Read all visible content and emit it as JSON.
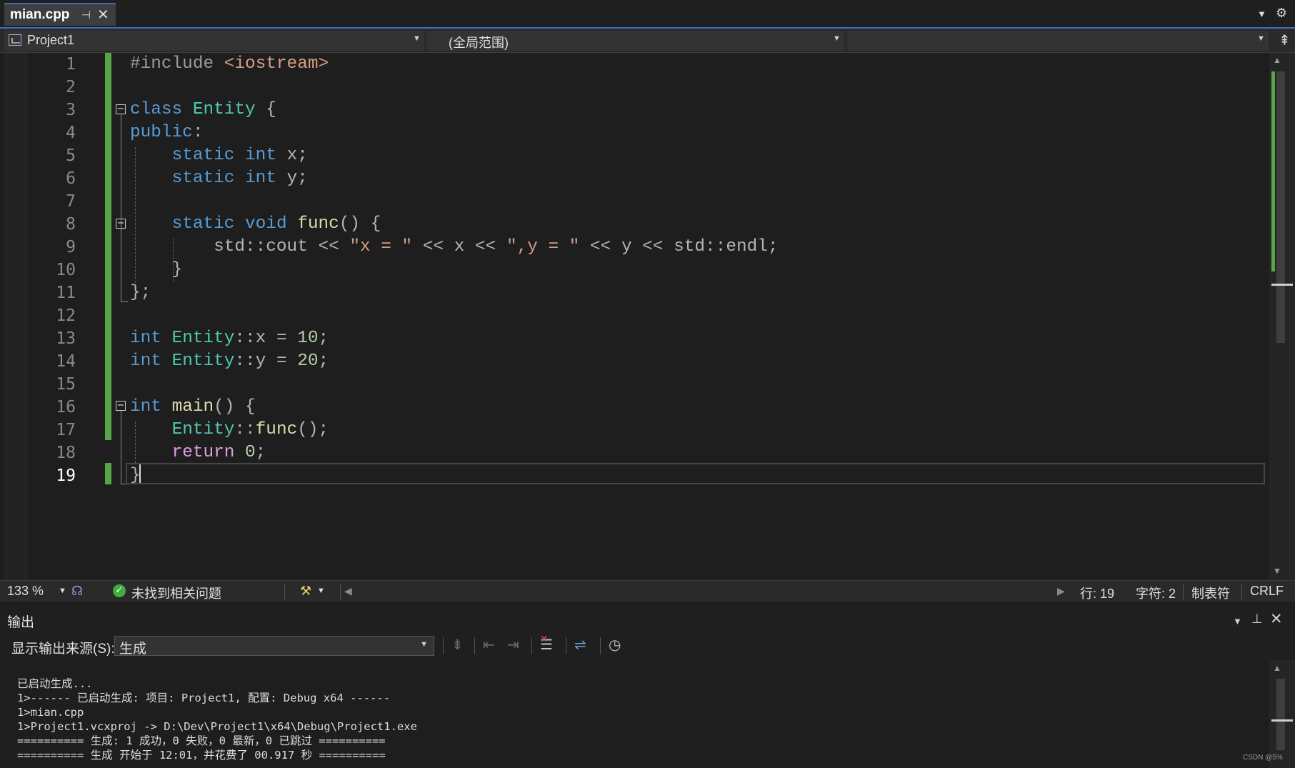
{
  "tab": {
    "title": "mian.cpp",
    "pin_icon": "pin-icon",
    "close_icon": "close-icon"
  },
  "navbar": {
    "project": "Project1",
    "scope": "(全局范围)",
    "member": ""
  },
  "editor": {
    "line_numbers": [
      "1",
      "2",
      "3",
      "4",
      "5",
      "6",
      "7",
      "8",
      "9",
      "10",
      "11",
      "12",
      "13",
      "14",
      "15",
      "16",
      "17",
      "18",
      "19"
    ],
    "current_line": 19,
    "code": [
      [
        [
          "pp",
          "#include "
        ],
        [
          "st",
          "<iostream>"
        ]
      ],
      [],
      [
        [
          "kw",
          "class "
        ],
        [
          "ty",
          "Entity "
        ],
        [
          "pu",
          "{"
        ]
      ],
      [
        [
          "kw",
          "public"
        ],
        [
          "pu",
          ":"
        ]
      ],
      [
        [
          "pu",
          "    "
        ],
        [
          "kw",
          "static "
        ],
        [
          "kw",
          "int "
        ],
        [
          "pu",
          "x;"
        ]
      ],
      [
        [
          "pu",
          "    "
        ],
        [
          "kw",
          "static "
        ],
        [
          "kw",
          "int "
        ],
        [
          "pu",
          "y;"
        ]
      ],
      [],
      [
        [
          "pu",
          "    "
        ],
        [
          "kw",
          "static "
        ],
        [
          "kw",
          "void "
        ],
        [
          "fn",
          "func"
        ],
        [
          "pu",
          "() {"
        ]
      ],
      [
        [
          "pu",
          "        std::cout << "
        ],
        [
          "st",
          "\"x = \""
        ],
        [
          "pu",
          " << x << "
        ],
        [
          "st",
          "\",y = \""
        ],
        [
          "pu",
          " << y << std::endl;"
        ]
      ],
      [
        [
          "pu",
          "    }"
        ]
      ],
      [
        [
          "pu",
          "};"
        ]
      ],
      [],
      [
        [
          "kw",
          "int "
        ],
        [
          "ty",
          "Entity"
        ],
        [
          "pu",
          "::x = "
        ],
        [
          "nm",
          "10"
        ],
        [
          "pu",
          ";"
        ]
      ],
      [
        [
          "kw",
          "int "
        ],
        [
          "ty",
          "Entity"
        ],
        [
          "pu",
          "::y = "
        ],
        [
          "nm",
          "20"
        ],
        [
          "pu",
          ";"
        ]
      ],
      [],
      [
        [
          "kw",
          "int "
        ],
        [
          "fn",
          "main"
        ],
        [
          "pu",
          "() {"
        ]
      ],
      [
        [
          "pu",
          "    "
        ],
        [
          "ty",
          "Entity"
        ],
        [
          "pu",
          "::"
        ],
        [
          "fn",
          "func"
        ],
        [
          "pu",
          "();"
        ]
      ],
      [
        [
          "pu",
          "    "
        ],
        [
          "ctl",
          "return "
        ],
        [
          "nm",
          "0"
        ],
        [
          "pu",
          ";"
        ]
      ],
      [
        [
          "pu",
          "}"
        ]
      ]
    ]
  },
  "status": {
    "zoom": "133 %",
    "issues": "未找到相关问题",
    "line": "行: 19",
    "char": "字符: 2",
    "indent": "制表符",
    "eol": "CRLF"
  },
  "output": {
    "title": "输出",
    "source_label": "显示输出来源(S):",
    "source_value": "生成",
    "lines": [
      "已启动生成...",
      "1>------ 已启动生成: 项目: Project1, 配置: Debug x64 ------",
      "1>mian.cpp",
      "1>Project1.vcxproj -> D:\\Dev\\Project1\\x64\\Debug\\Project1.exe",
      "========== 生成: 1 成功，0 失败，0 最新，0 已跳过 ==========",
      "========== 生成 开始于 12:01，并花费了 00.917 秒 =========="
    ]
  },
  "watermark": "CSDN @5%",
  "colors": {
    "accent": "#3d6ec4",
    "change_bar": "#57a64a",
    "keyword": "#569cd6",
    "type": "#4ec9b0",
    "string": "#d69d85"
  }
}
